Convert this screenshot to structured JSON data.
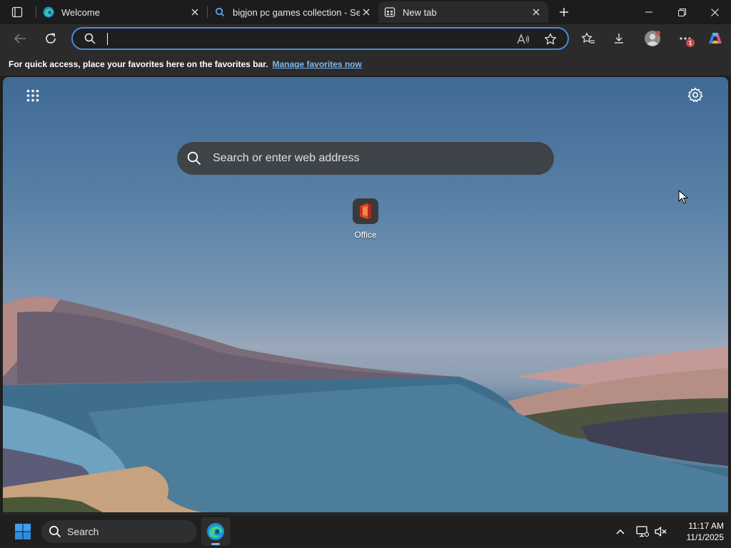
{
  "tabs": [
    {
      "title": "Welcome",
      "icon": "edge-icon",
      "active": false
    },
    {
      "title": "bigjon pc games collection - Sear",
      "icon": "search-icon",
      "active": false
    },
    {
      "title": "New tab",
      "icon": "newtab-icon",
      "active": true
    }
  ],
  "address_bar": {
    "value": "",
    "placeholder": ""
  },
  "favorites_bar": {
    "message": "For quick access, place your favorites here on the favorites bar.",
    "link": "Manage favorites now"
  },
  "ntp": {
    "search_placeholder": "Search or enter web address",
    "tiles": [
      {
        "label": "Office",
        "icon": "office-icon"
      }
    ]
  },
  "extensions_badge": "1",
  "taskbar": {
    "search_label": "Search",
    "time": "11:17 AM",
    "date": "11/1/2025"
  },
  "colors": {
    "accent": "#4a8bd6",
    "link": "#7fb8f0",
    "badge": "#c94a4a"
  }
}
